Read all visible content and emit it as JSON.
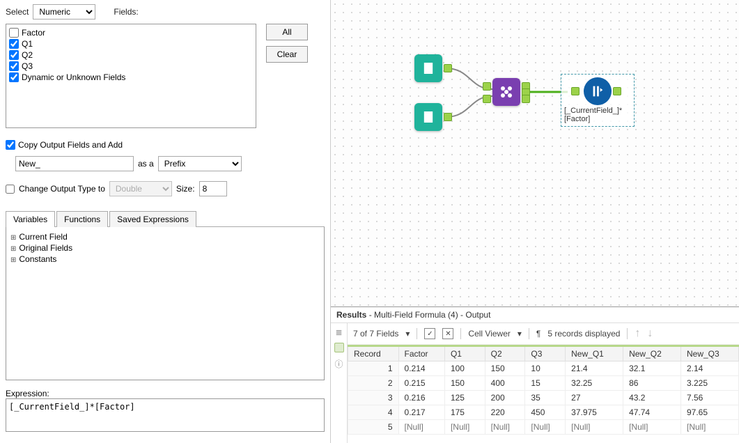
{
  "left": {
    "selectLabel": "Select",
    "selectValue": "Numeric",
    "fieldsLabel": "Fields:",
    "fieldItems": [
      {
        "label": "Factor",
        "checked": false
      },
      {
        "label": "Q1",
        "checked": true
      },
      {
        "label": "Q2",
        "checked": true
      },
      {
        "label": "Q3",
        "checked": true
      },
      {
        "label": "Dynamic or Unknown Fields",
        "checked": true
      }
    ],
    "allBtn": "All",
    "clearBtn": "Clear",
    "copyOutput": {
      "label": "Copy Output Fields and Add",
      "checked": true
    },
    "prefixValue": "New_",
    "asALabel": "as a",
    "prefixSuffixValue": "Prefix",
    "changeType": {
      "label": "Change Output Type to",
      "checked": false,
      "typeValue": "Double",
      "sizeLabel": "Size:",
      "sizeValue": "8"
    },
    "tabs": [
      "Variables",
      "Functions",
      "Saved Expressions"
    ],
    "activeTab": 0,
    "tree": [
      "Current Field",
      "Original Fields",
      "Constants"
    ],
    "expressionLabel": "Expression:",
    "expressionValue": "[_CurrentField_]*[Factor]"
  },
  "canvas": {
    "formulaCaption": "[_CurrentField_]*[Factor]"
  },
  "results": {
    "titlePrefix": "Results",
    "titleRest": " - Multi-Field Formula (4) - Output",
    "fieldsSummary": "7 of 7 Fields",
    "cellViewerLabel": "Cell Viewer",
    "recordsLabel": "5 records displayed",
    "columns": [
      "Record",
      "Factor",
      "Q1",
      "Q2",
      "Q3",
      "New_Q1",
      "New_Q2",
      "New_Q3"
    ],
    "rows": [
      [
        "1",
        "0.214",
        "100",
        "150",
        "10",
        "21.4",
        "32.1",
        "2.14"
      ],
      [
        "2",
        "0.215",
        "150",
        "400",
        "15",
        "32.25",
        "86",
        "3.225"
      ],
      [
        "3",
        "0.216",
        "125",
        "200",
        "35",
        "27",
        "43.2",
        "7.56"
      ],
      [
        "4",
        "0.217",
        "175",
        "220",
        "450",
        "37.975",
        "47.74",
        "97.65"
      ],
      [
        "5",
        "[Null]",
        "[Null]",
        "[Null]",
        "[Null]",
        "[Null]",
        "[Null]",
        "[Null]"
      ]
    ]
  }
}
